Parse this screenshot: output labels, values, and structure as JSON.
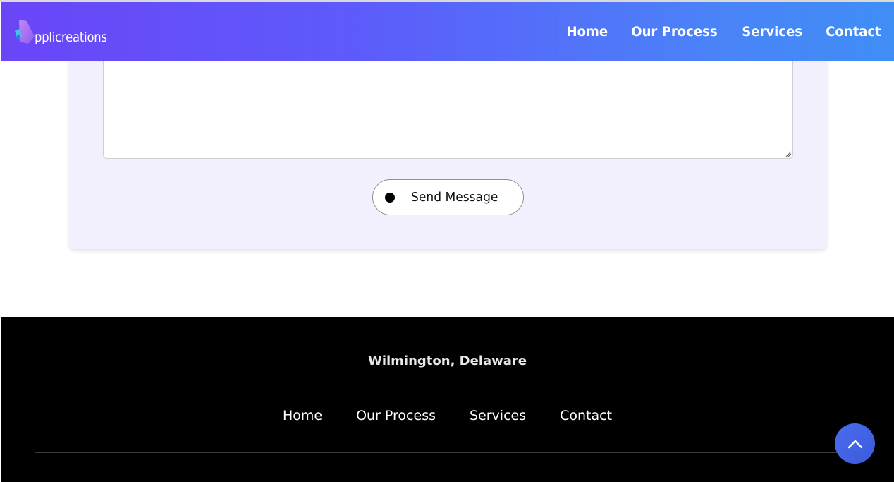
{
  "brand": {
    "logo_text": "pplicreations",
    "colors": {
      "gradient_start": "#6a45f7",
      "gradient_end": "#3f8ef5",
      "card_bg": "#f3f0fd",
      "footer_bg": "#000000",
      "accent": "#4a6cf0"
    }
  },
  "header": {
    "nav": [
      {
        "label": "Home"
      },
      {
        "label": "Our Process"
      },
      {
        "label": "Services"
      },
      {
        "label": "Contact"
      }
    ]
  },
  "form": {
    "message_value": "",
    "send_label": "Send Message"
  },
  "footer": {
    "address": "Wilmington, Delaware",
    "nav": [
      {
        "label": "Home"
      },
      {
        "label": "Our Process"
      },
      {
        "label": "Services"
      },
      {
        "label": "Contact"
      }
    ]
  },
  "icons": {
    "scroll_top": "chevron-up-icon",
    "send": "dot-icon",
    "logo": "logo-mark-icon"
  }
}
